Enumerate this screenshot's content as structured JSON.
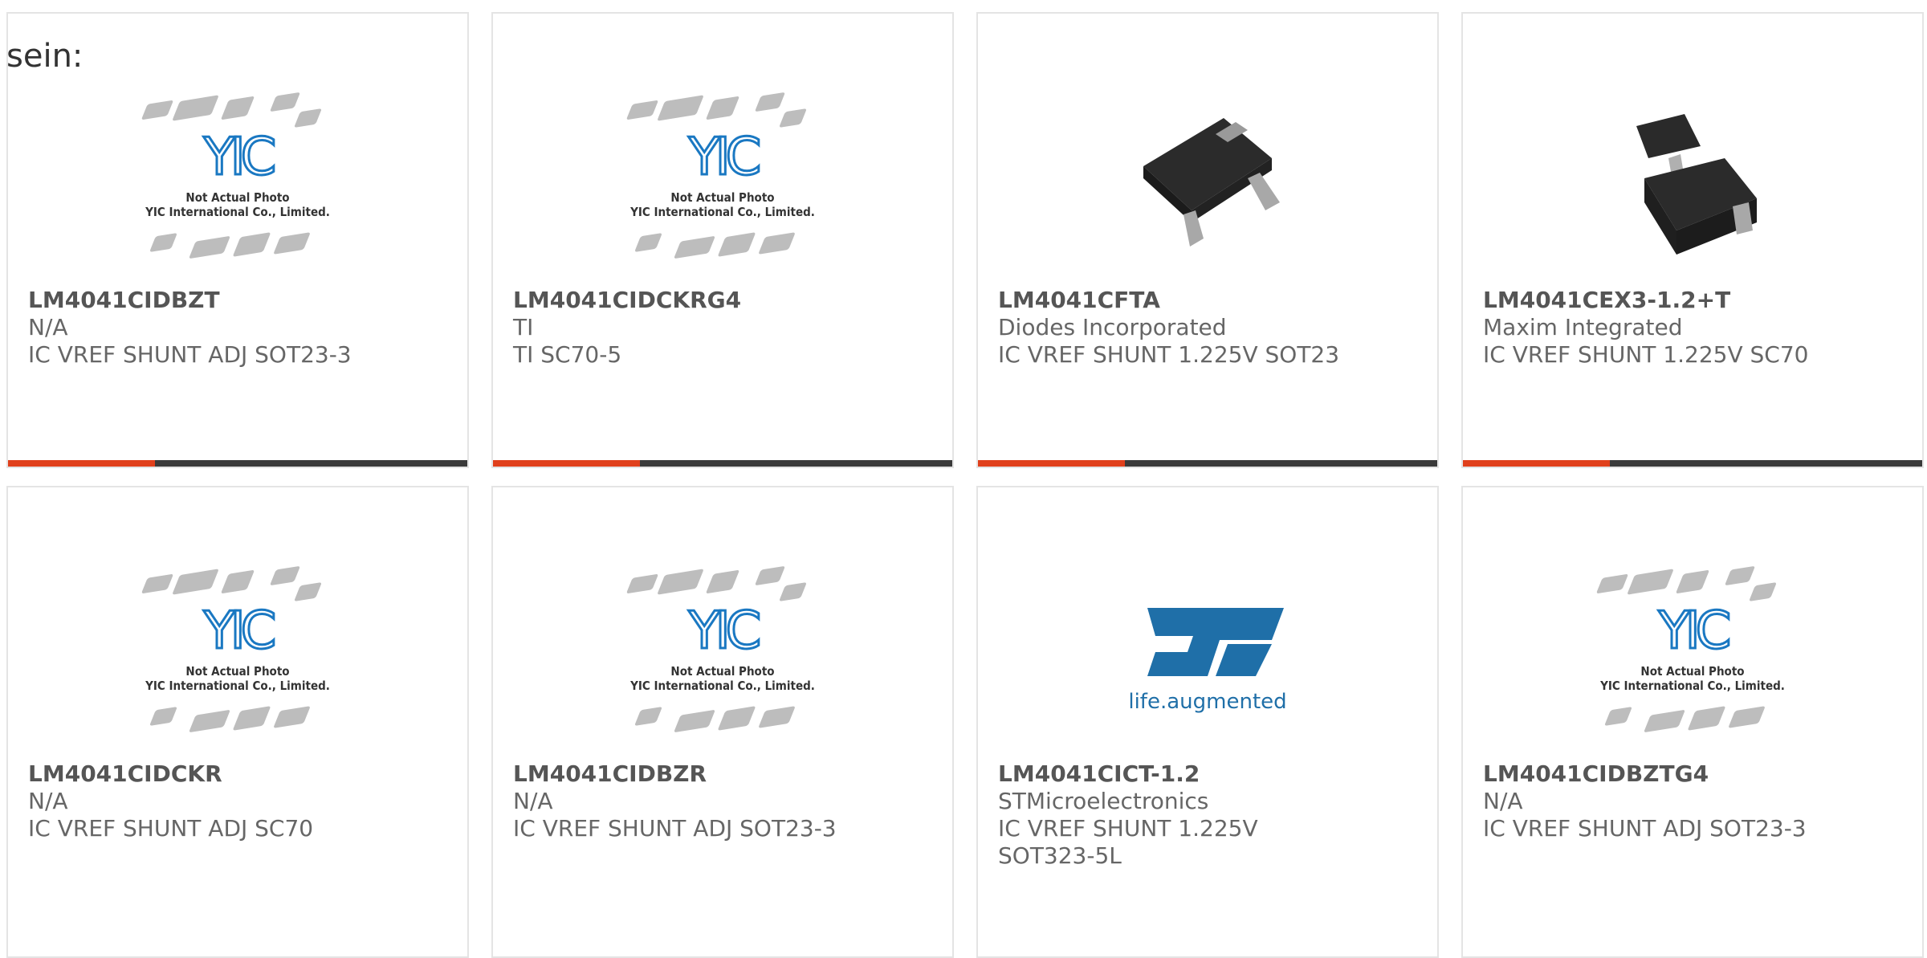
{
  "intro_text": "sein:",
  "placeholder": {
    "caption_line1": "Not Actual Photo",
    "caption_line2": "YIC International Co., Limited.",
    "logo_text": "YIC"
  },
  "st_logo_tagline": "life.augmented",
  "products": [
    {
      "part": "LM4041CIDBZT",
      "maker": "N/A",
      "desc": "IC VREF SHUNT ADJ SOT23-3",
      "image": "placeholder"
    },
    {
      "part": "LM4041CIDCKRG4",
      "maker": "TI",
      "desc": "TI SC70-5",
      "image": "placeholder"
    },
    {
      "part": "LM4041CFTA",
      "maker": "Diodes Incorporated",
      "desc": "IC VREF SHUNT 1.225V SOT23",
      "image": "sot23-photo"
    },
    {
      "part": "LM4041CEX3-1.2+T",
      "maker": "Maxim Integrated",
      "desc": "IC VREF SHUNT 1.225V SC70",
      "image": "sc70-photo"
    },
    {
      "part": "LM4041CIDCKR",
      "maker": "N/A",
      "desc": "IC VREF SHUNT ADJ SC70",
      "image": "placeholder"
    },
    {
      "part": "LM4041CIDBZR",
      "maker": "N/A",
      "desc": "IC VREF SHUNT ADJ SOT23-3",
      "image": "placeholder"
    },
    {
      "part": "LM4041CICT-1.2",
      "maker": "STMicroelectronics",
      "desc": "IC VREF SHUNT 1.225V SOT323-5L",
      "image": "st-logo"
    },
    {
      "part": "LM4041CIDBZTG4",
      "maker": "N/A",
      "desc": "IC VREF SHUNT ADJ SOT23-3",
      "image": "placeholder"
    }
  ],
  "colors": {
    "accent": "#e0401c",
    "bar_dark": "#3a3a3a",
    "yic_blue": "#1a78c2",
    "st_blue": "#1f6fa8"
  }
}
